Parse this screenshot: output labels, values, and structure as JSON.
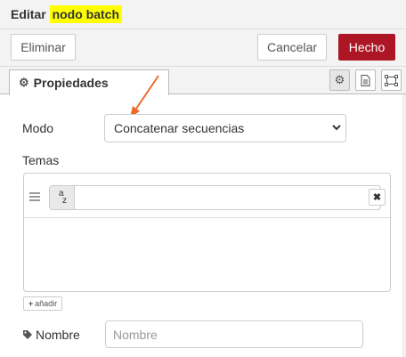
{
  "header": {
    "title_prefix": "Editar",
    "title_highlight": "nodo batch"
  },
  "buttons": {
    "delete": "Eliminar",
    "cancel": "Cancelar",
    "done": "Hecho"
  },
  "tabs": [
    {
      "label": "Propiedades",
      "icon": "gear-icon"
    }
  ],
  "tab_buttons": [
    "gear-icon",
    "document-icon",
    "appearance-icon"
  ],
  "form": {
    "mode_label": "Modo",
    "mode_value": "Concatenar secuencias",
    "topics_label": "Temas",
    "topics": [
      {
        "type_icon": "az-string-icon",
        "value": ""
      }
    ],
    "add_label": "añadir",
    "name_label": "Nombre",
    "name_value": "",
    "name_placeholder": "Nombre"
  },
  "colors": {
    "primary": "#ad1625",
    "highlight": "#ffff00",
    "annotation_arrow": "#ee6a2b"
  }
}
